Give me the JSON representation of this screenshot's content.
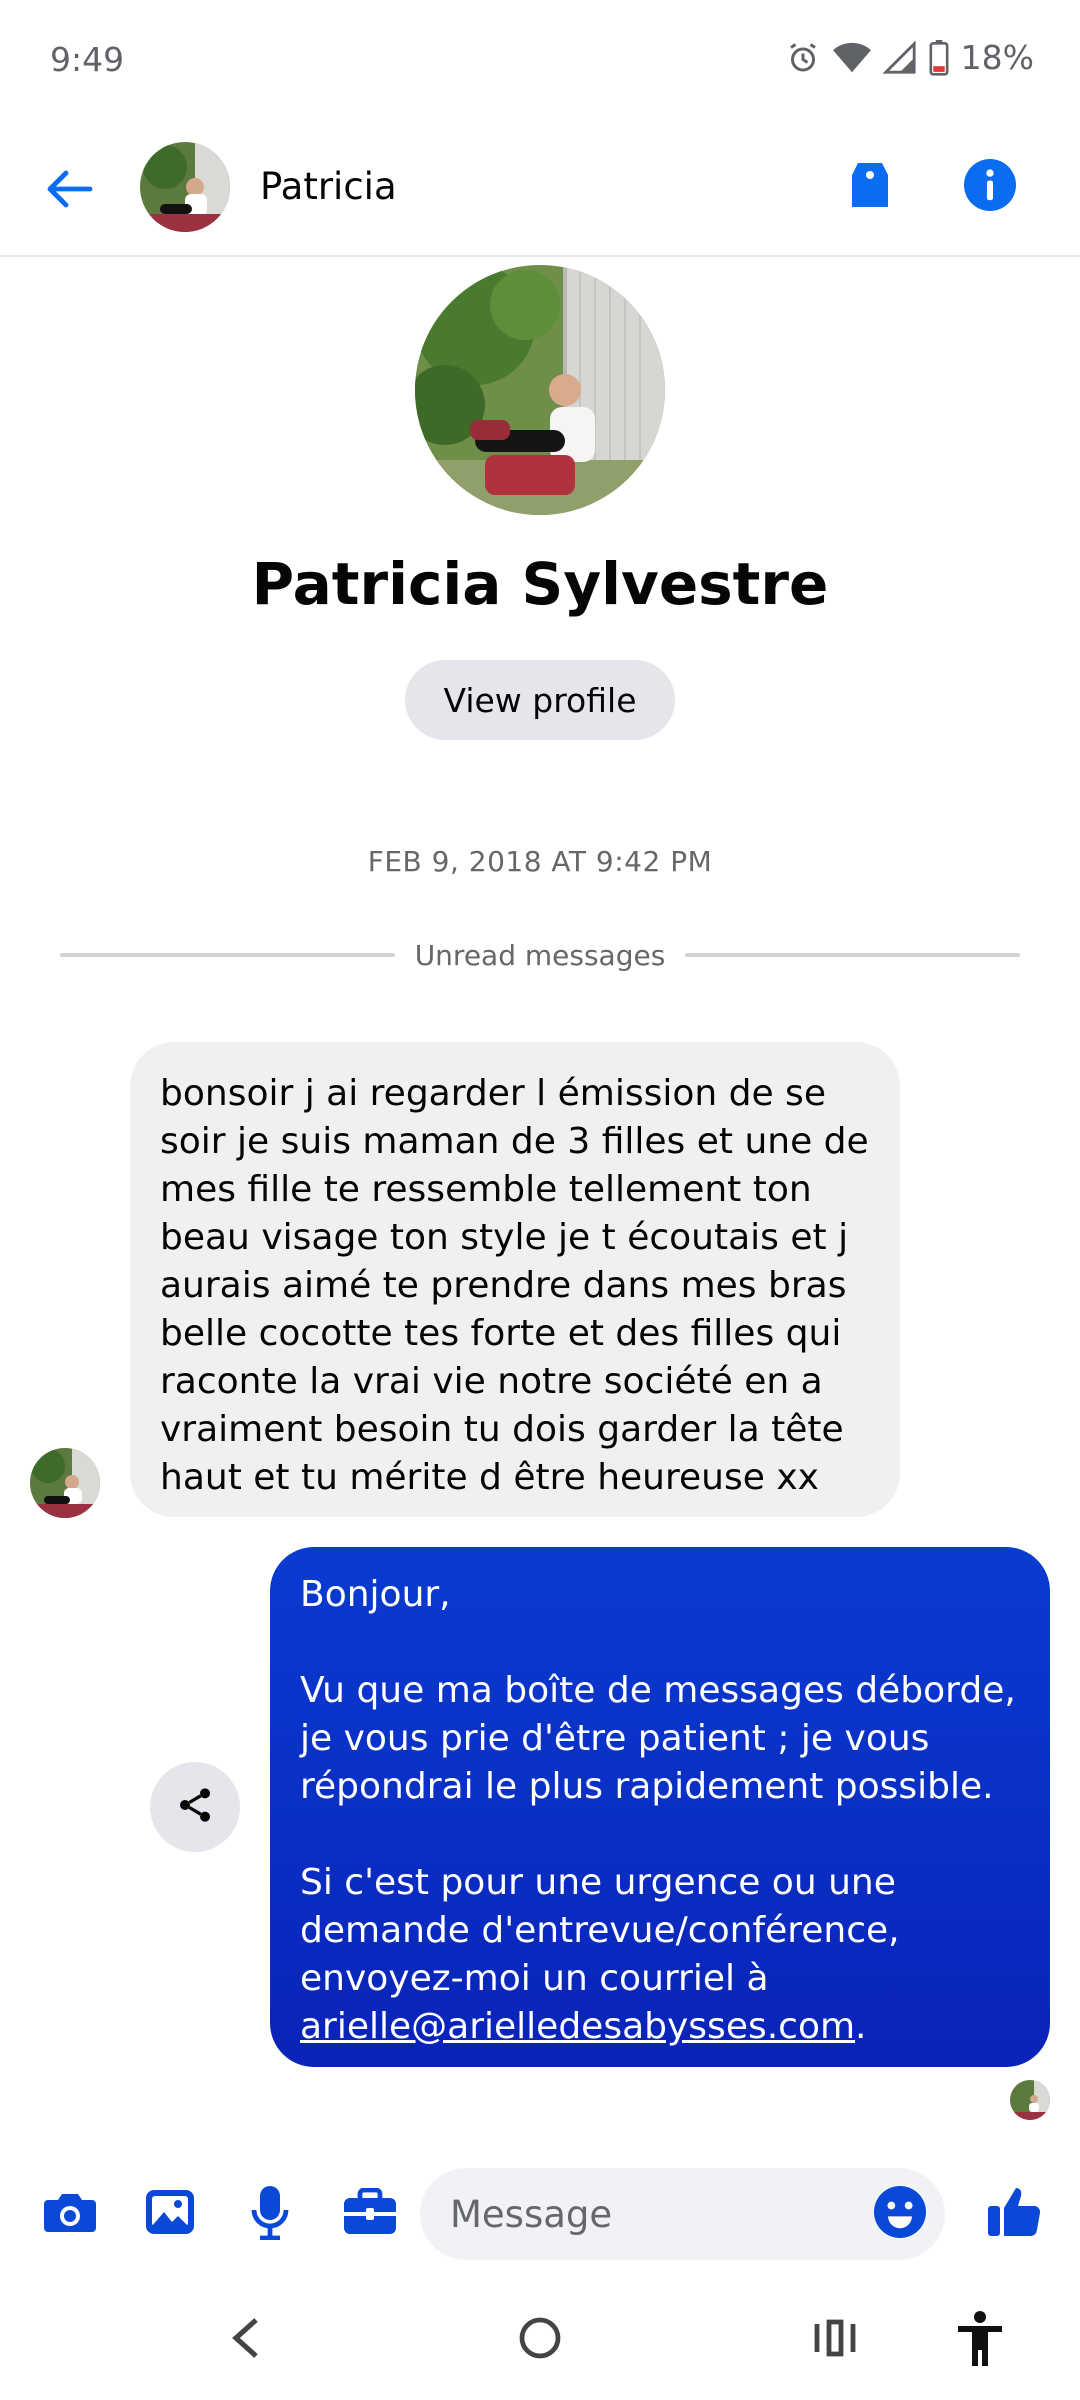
{
  "status_bar": {
    "time": "9:49",
    "battery": "18%",
    "icons": [
      "alarm-icon",
      "wifi-icon",
      "signal-icon",
      "battery-icon"
    ]
  },
  "header": {
    "contact_name": "Patricia",
    "icons": [
      "back-arrow-icon",
      "tag-icon",
      "info-icon"
    ]
  },
  "profile": {
    "full_name": "Patricia Sylvestre",
    "view_profile_label": "View profile"
  },
  "conversation": {
    "timestamp": "FEB 9, 2018 AT 9:42 PM",
    "unread_label": "Unread messages",
    "messages": [
      {
        "direction": "incoming",
        "lines": [
          "bonsoir j ai regarder l émission de se",
          "soir je suis maman de 3 filles et une de",
          "mes fille te ressemble tellement ton",
          "beau visage ton style je t écoutais et j",
          "aurais aimé te prendre dans mes bras",
          "belle cocotte tes forte et des filles qui",
          "raconte la vrai vie notre société en a",
          "vraiment besoin tu dois garder la tête",
          "haut et tu mérite d être heureuse xx"
        ]
      },
      {
        "direction": "outgoing",
        "greeting": "Bonjour,",
        "paragraph1": [
          "Vu que ma boîte de messages déborde,",
          "je vous prie d'être patient ; je vous",
          "répondrai le plus rapidement possible."
        ],
        "paragraph2": [
          "Si c'est pour une urgence ou une",
          "demande d'entrevue/conférence,",
          "envoyez-moi un courriel à"
        ],
        "email": "arielle@arielledesabysses.com",
        "email_suffix": "."
      }
    ]
  },
  "composer": {
    "placeholder": "Message",
    "icons": [
      "camera-icon",
      "gallery-icon",
      "microphone-icon",
      "briefcase-icon",
      "emoji-icon",
      "thumbs-up-icon"
    ]
  },
  "colors": {
    "accent": "#0a49d8",
    "outgoing_bubble": "#0a2fc6",
    "incoming_bubble": "#f0f0f3"
  }
}
